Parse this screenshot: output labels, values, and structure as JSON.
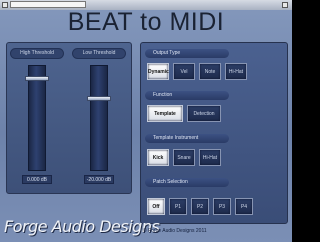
{
  "window": {
    "title": "BEAT to MIDI"
  },
  "sliders": [
    {
      "label": "High Threshold",
      "value": "0.000 dB"
    },
    {
      "label": "Low Threshold",
      "value": "-20.000 dB"
    }
  ],
  "output_type": {
    "label": "Output Type",
    "buttons": [
      {
        "label": "Dynamic",
        "selected": true
      },
      {
        "label": "Vel",
        "selected": false
      },
      {
        "label": "Note",
        "selected": false
      },
      {
        "label": "Hi-Hat",
        "selected": false
      }
    ]
  },
  "function": {
    "label": "Function",
    "buttons": [
      {
        "label": "Template",
        "selected": true
      },
      {
        "label": "Detection",
        "selected": false
      }
    ]
  },
  "template_instrument": {
    "label": "Template Instrument",
    "buttons": [
      {
        "label": "Kick",
        "selected": true
      },
      {
        "label": "Snare",
        "selected": false
      },
      {
        "label": "Hi-Hat",
        "selected": false
      }
    ]
  },
  "patch_selection": {
    "label": "Patch Selection",
    "buttons": [
      {
        "label": "Off",
        "selected": true
      },
      {
        "label": "P1",
        "selected": false
      },
      {
        "label": "P2",
        "selected": false
      },
      {
        "label": "P3",
        "selected": false
      },
      {
        "label": "P4",
        "selected": false
      }
    ]
  },
  "footer": {
    "copyright": "© Forge Audio Designs 2011",
    "logo": "Forge Audio Designs"
  }
}
